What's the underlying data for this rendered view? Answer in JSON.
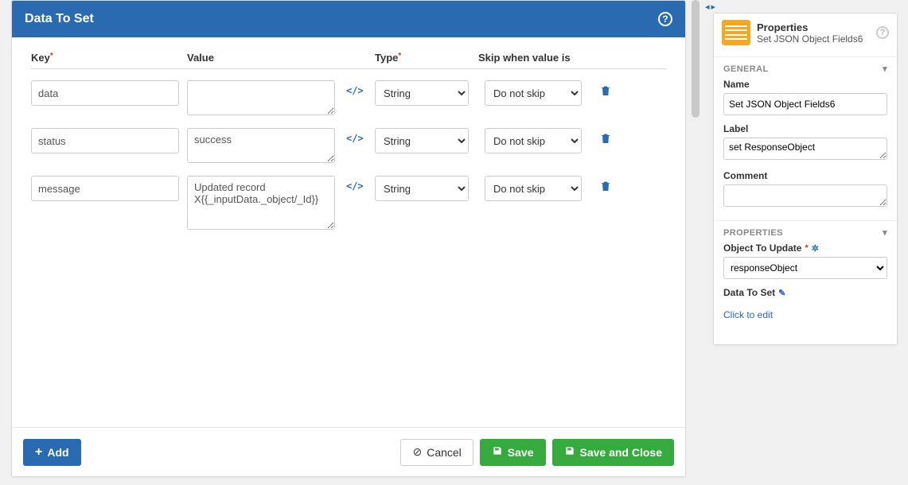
{
  "dialog": {
    "title": "Data To Set",
    "columns": {
      "key": "Key",
      "value": "Value",
      "type": "Type",
      "skip": "Skip when value is"
    },
    "rows": [
      {
        "key": "data",
        "value": "",
        "type": "String",
        "skip": "Do not skip"
      },
      {
        "key": "status",
        "value": "success",
        "type": "String",
        "skip": "Do not skip"
      },
      {
        "key": "message",
        "value": "Updated record X{{_inputData._object/_Id}}",
        "type": "String",
        "skip": "Do not skip"
      }
    ],
    "buttons": {
      "add": "Add",
      "cancel": "Cancel",
      "save": "Save",
      "save_close": "Save and Close"
    }
  },
  "properties_panel": {
    "header": {
      "title": "Properties",
      "subtitle": "Set JSON Object Fields6"
    },
    "sections": {
      "general": {
        "label": "GENERAL",
        "name_label": "Name",
        "name_value": "Set JSON Object Fields6",
        "label_label": "Label",
        "label_value": "set ResponseObject",
        "comment_label": "Comment",
        "comment_value": ""
      },
      "props": {
        "label": "PROPERTIES",
        "obj_label": "Object To Update",
        "obj_value": "responseObject",
        "data_to_set_label": "Data To Set",
        "edit_link": "Click to edit"
      }
    }
  }
}
